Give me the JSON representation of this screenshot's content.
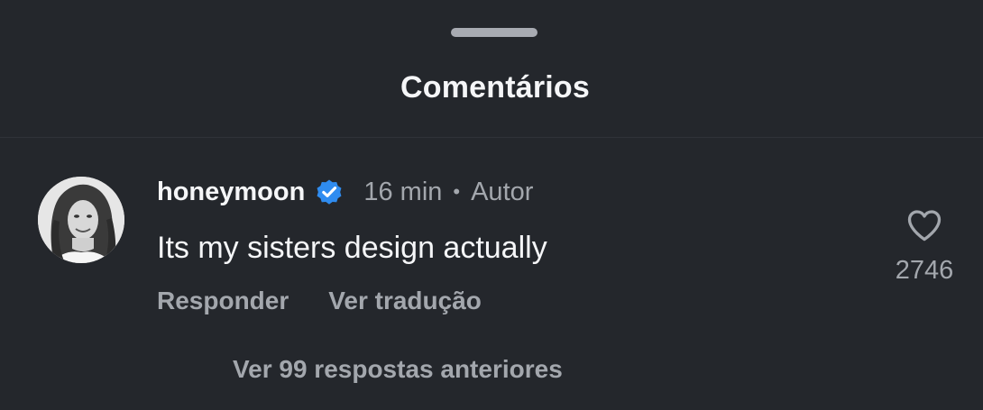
{
  "sheet": {
    "title": "Comentários"
  },
  "comment": {
    "username": "honeymoon",
    "verified": true,
    "time": "16 min",
    "separator": "•",
    "author_label": "Autor",
    "text": "Its my sisters design actually",
    "actions": {
      "reply": "Responder",
      "translate": "Ver tradução"
    },
    "likes": {
      "count": "2746",
      "icon": "heart-outline-icon"
    }
  },
  "replies": {
    "view_previous": "Ver 99 respostas anteriores"
  },
  "colors": {
    "background": "#24272c",
    "primary_text": "#f5f6f8",
    "secondary_text": "#a3a7ad",
    "verified_badge": "#2f8cf0",
    "handle": "#a8abb2"
  },
  "icons": {
    "handle": "drag-handle",
    "verified": "verified-badge-icon",
    "avatar": "profile-avatar",
    "like": "heart-outline-icon"
  }
}
